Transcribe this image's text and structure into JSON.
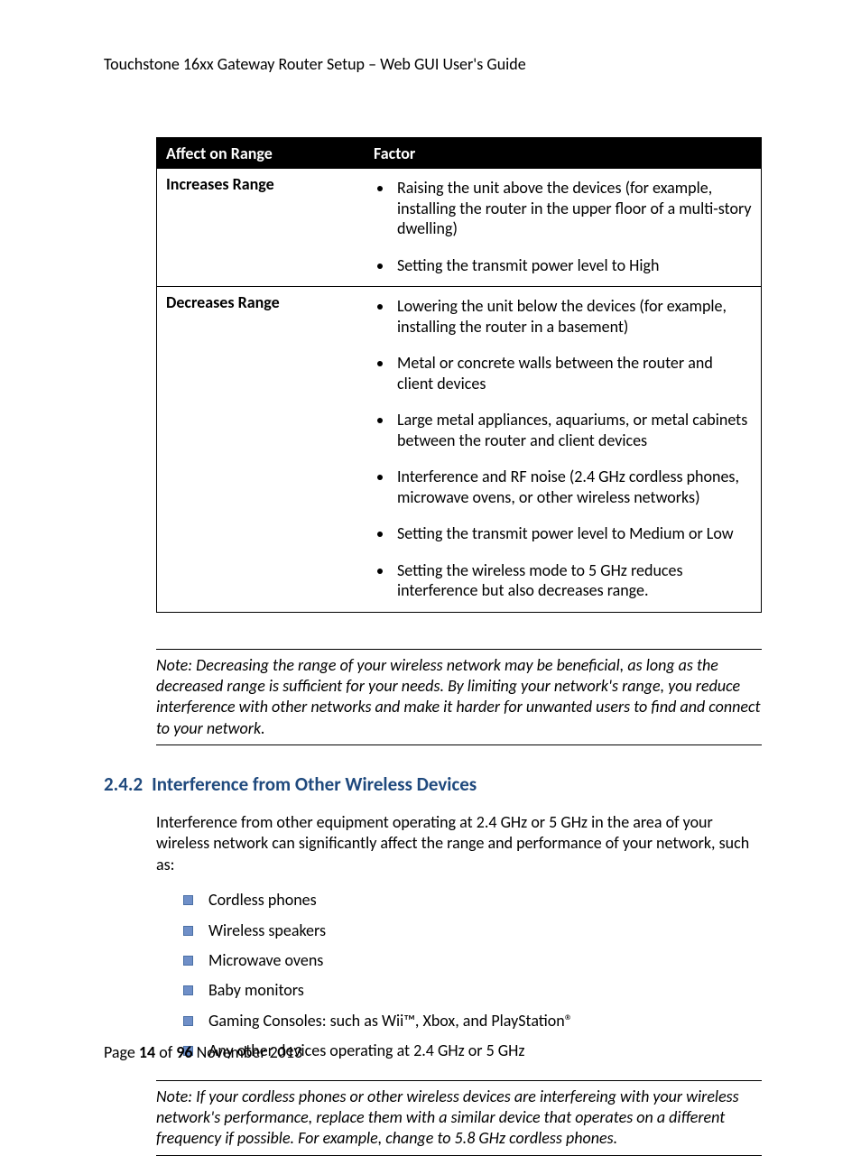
{
  "header": "Touchstone 16xx Gateway Router Setup – Web GUI User's Guide",
  "table": {
    "col1_header": "Affect on Range",
    "col2_header": "Factor",
    "rows": [
      {
        "label": "Increases Range",
        "items": [
          "Raising the unit above the devices (for example, installing the router  in the upper floor of a multi-story dwelling)",
          "Setting the transmit power level to High"
        ]
      },
      {
        "label": "Decreases Range",
        "items": [
          "Lowering the unit below the devices (for example, installing the router  in a basement)",
          "Metal or concrete walls between the router and client devices",
          "Large metal appliances, aquariums, or metal cabinets between the router and client devices",
          "Interference and RF noise (2.4 GHz cordless phones, microwave ovens, or other wireless networks)",
          "Setting the transmit power level to Medium or Low",
          "Setting the wireless mode to 5 GHz reduces interference but also decreases range."
        ]
      }
    ]
  },
  "note1": "Note:  Decreasing the range of your wireless network may be beneficial, as long as the decreased range is sufficient for your needs.  By limiting your network's range, you reduce interference with other networks and make it harder for unwanted users to find and connect to your network.",
  "section": {
    "number": "2.4.2",
    "title": "Interference from Other Wireless Devices"
  },
  "intro": "Interference from other equipment operating at 2.4 GHz or 5 GHz in the area of your wireless network can significantly affect the range and performance of your network, such as:",
  "devices": [
    "Cordless phones",
    "Wireless speakers",
    "Microwave ovens",
    "Baby monitors",
    "Gaming Consoles: such as Wii™, Xbox, and PlayStation®",
    "Any other devices operating at 2.4 GHz or 5 GHz"
  ],
  "note2": "Note:  If your cordless phones or other wireless devices are interfereing with your wireless network's performance, replace them with a similar device that operates on a different frequency if possible.  For example, change to 5.8 GHz cordless phones.",
  "footer": {
    "page_label": "Page ",
    "page_num": "14",
    "of_label": " of ",
    "total": "96",
    "date": "   November 2013"
  }
}
